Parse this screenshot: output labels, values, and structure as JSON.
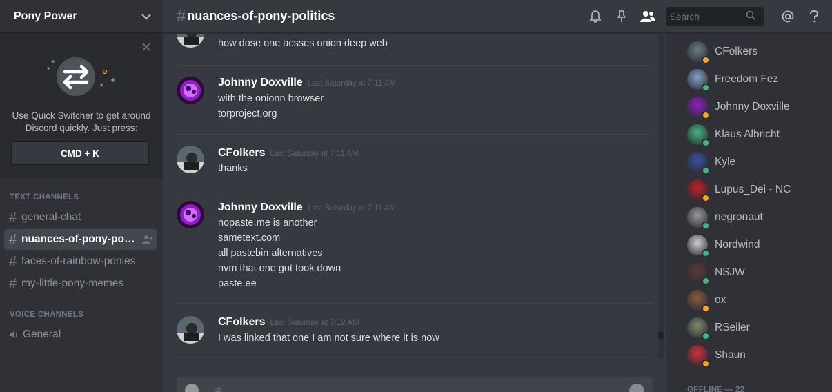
{
  "server": {
    "name": "Pony Power"
  },
  "quick_switcher": {
    "text": "Use Quick Switcher to get around Discord quickly. Just press:",
    "shortcut": "CMD + K"
  },
  "channels": {
    "text_category": "TEXT CHANNELS",
    "text_channels": [
      {
        "label": "general-chat",
        "active": false
      },
      {
        "label": "nuances-of-pony-politics",
        "active": true
      },
      {
        "label": "faces-of-rainbow-ponies",
        "active": false
      },
      {
        "label": "my-little-pony-memes",
        "active": false
      }
    ],
    "voice_category": "VOICE CHANNELS",
    "voice_channels": [
      {
        "label": "General"
      }
    ]
  },
  "header": {
    "hash": "#",
    "channel_name": "nuances-of-pony-politics",
    "search_placeholder": "Search",
    "icons": [
      "bell-icon",
      "pin-icon",
      "members-icon",
      "search-icon",
      "mention-icon",
      "help-icon"
    ]
  },
  "messages": [
    {
      "author": "",
      "timestamp": "",
      "lines": [
        "how dose one acsses onion deep web"
      ]
    },
    {
      "author": "Johnny Doxville",
      "timestamp": "Last Saturday at 7:11 AM",
      "lines": [
        "with the onionn browser",
        "torproject.org"
      ]
    },
    {
      "author": "CFolkers",
      "timestamp": "Last Saturday at 7:11 AM",
      "lines": [
        "thanks"
      ]
    },
    {
      "author": "Johnny Doxville",
      "timestamp": "Last Saturday at 7:11 AM",
      "lines": [
        "nopaste.me is another",
        "sametext.com",
        "all pastebin alternatives",
        "nvm that one got took down",
        "paste.ee"
      ]
    },
    {
      "author": "CFolkers",
      "timestamp": "Last Saturday at 7:12 AM",
      "lines": [
        "I was linked that one I am not sure where it is now"
      ]
    }
  ],
  "composer": {
    "text": "#"
  },
  "members": {
    "list": [
      {
        "name": "CFolkers",
        "status": "idle"
      },
      {
        "name": "Freedom Fez",
        "status": "online"
      },
      {
        "name": "Johnny Doxville",
        "status": "idle"
      },
      {
        "name": "Klaus Albricht",
        "status": "online"
      },
      {
        "name": "Kyle",
        "status": "online"
      },
      {
        "name": "Lupus_Dei - NC",
        "status": "idle"
      },
      {
        "name": "negronaut",
        "status": "online"
      },
      {
        "name": "Nordwind",
        "status": "online"
      },
      {
        "name": "NSJW",
        "status": "online"
      },
      {
        "name": "ox",
        "status": "idle"
      },
      {
        "name": "RSeiler",
        "status": "online"
      },
      {
        "name": "Shaun",
        "status": "idle"
      }
    ],
    "offline_label": "OFFLINE — 22"
  },
  "colors": {
    "online": "#43b581",
    "idle": "#faa61a",
    "background": "#36393f",
    "sidebar": "#2f3136"
  }
}
